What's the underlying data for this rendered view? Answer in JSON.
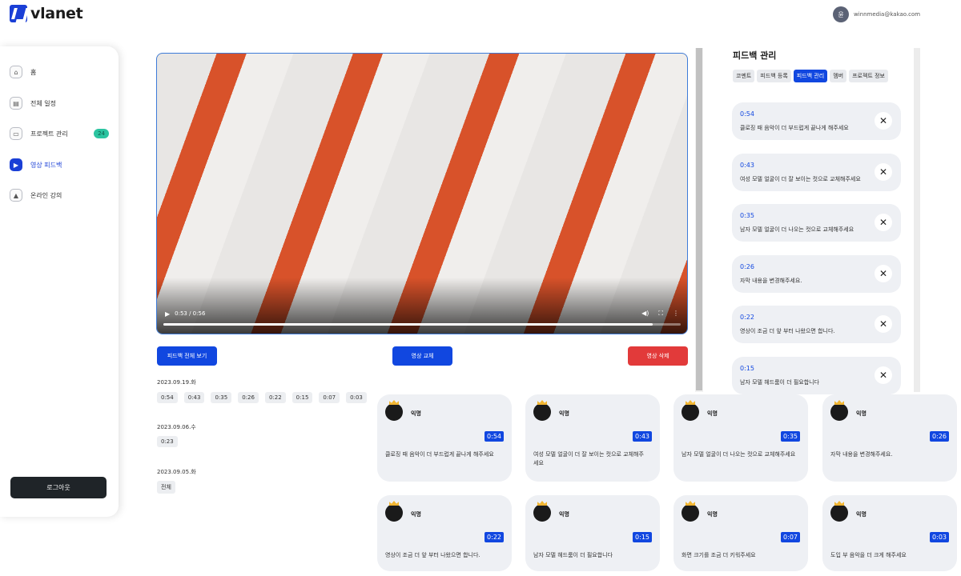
{
  "header": {
    "logo_text": "vlanet",
    "user_initial": "윤",
    "user_email": "winnmedia@kakao.com"
  },
  "sidebar": {
    "items": [
      {
        "label": "홈",
        "icon": "home-icon"
      },
      {
        "label": "전체 일정",
        "icon": "calendar-icon"
      },
      {
        "label": "프로젝트 관리",
        "icon": "folder-icon",
        "badge": "24"
      },
      {
        "label": "영상 피드백",
        "icon": "video-feedback-icon",
        "active": true
      },
      {
        "label": "온라인 강의",
        "icon": "graduation-cap-icon"
      }
    ],
    "logout_label": "로그아웃"
  },
  "video": {
    "time": "0:53 / 0:56",
    "progress_fraction": 0.946
  },
  "actions": {
    "view_all": "피드백 전체 보기",
    "replace": "영상 교체",
    "delete": "영상 삭제"
  },
  "history": [
    {
      "date": "2023.09.19.화",
      "chips": [
        "0:54",
        "0:43",
        "0:35",
        "0:26",
        "0:22",
        "0:15",
        "0:07",
        "0:03"
      ]
    },
    {
      "date": "2023.09.06.수",
      "chips": [
        "0:23"
      ]
    },
    {
      "date": "2023.09.05.화",
      "chips": [
        "전체"
      ]
    }
  ],
  "panel": {
    "title": "피드백 관리",
    "tabs": [
      "코멘트",
      "피드백 등록",
      "피드백 관리",
      "멤버",
      "프로젝트 정보"
    ],
    "active_tab": "피드백 관리",
    "feedbacks": [
      {
        "time": "0:54",
        "text": "클로징 때 음악이 더 부드럽게 끝나게 해주세요"
      },
      {
        "time": "0:43",
        "text": "여성 모델 얼굴이 더 잘 보이는 컷으로 교체해주세요"
      },
      {
        "time": "0:35",
        "text": "남자 모델 얼굴이 더 나오는 컷으로 교체해주세요"
      },
      {
        "time": "0:26",
        "text": "자막 내용을 변경해주세요."
      },
      {
        "time": "0:22",
        "text": "영상이 조금 더 앞 부터 나왔으면 합니다."
      },
      {
        "time": "0:15",
        "text": "남자 모델 헤드룸이 더 필요합니다"
      }
    ]
  },
  "cards": [
    {
      "name": "익명",
      "time": "0:54",
      "text": "클로징 때 음악이 더 부드럽게 끝나게 해주세요"
    },
    {
      "name": "익명",
      "time": "0:43",
      "text": "여성 모델 얼굴이 더 잘 보이는 컷으로 교체해주세요"
    },
    {
      "name": "익명",
      "time": "0:35",
      "text": "남자 모델 얼굴이 더 나오는 컷으로 교체해주세요"
    },
    {
      "name": "익명",
      "time": "0:26",
      "text": "자막 내용을 변경해주세요."
    },
    {
      "name": "익명",
      "time": "0:22",
      "text": "영상이 조금 더 앞 부터 나왔으면 합니다."
    },
    {
      "name": "익명",
      "time": "0:15",
      "text": "남자 모델 헤드룸이 더 필요합니다"
    },
    {
      "name": "익명",
      "time": "0:07",
      "text": "화면 크기를 조금 더 키워주세요"
    },
    {
      "name": "익명",
      "time": "0:03",
      "text": "도입 부 음악을 더 크게 해주세요"
    }
  ],
  "colors": {
    "accent": "#1147e0",
    "danger": "#e23a3a",
    "badge": "#2bc4a0",
    "logout": "#1f2428"
  }
}
